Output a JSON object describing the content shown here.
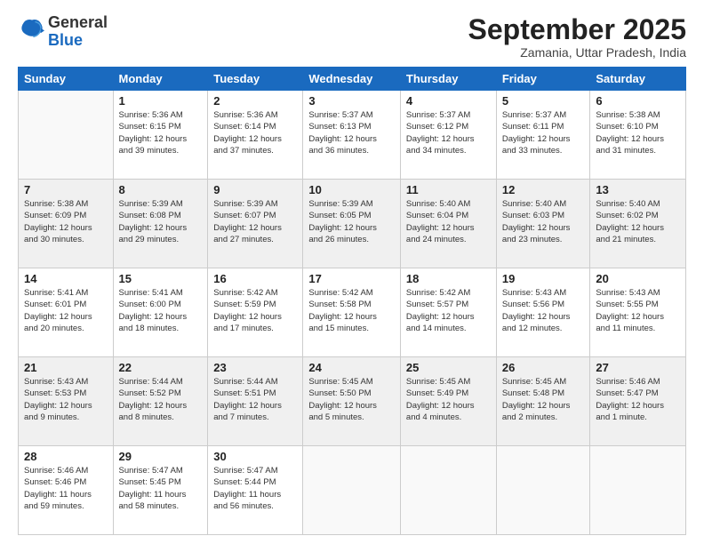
{
  "header": {
    "logo": {
      "line1": "General",
      "line2": "Blue"
    },
    "title": "September 2025",
    "subtitle": "Zamania, Uttar Pradesh, India"
  },
  "calendar": {
    "days_of_week": [
      "Sunday",
      "Monday",
      "Tuesday",
      "Wednesday",
      "Thursday",
      "Friday",
      "Saturday"
    ],
    "weeks": [
      [
        {
          "day": "",
          "info": ""
        },
        {
          "day": "1",
          "info": "Sunrise: 5:36 AM\nSunset: 6:15 PM\nDaylight: 12 hours\nand 39 minutes."
        },
        {
          "day": "2",
          "info": "Sunrise: 5:36 AM\nSunset: 6:14 PM\nDaylight: 12 hours\nand 37 minutes."
        },
        {
          "day": "3",
          "info": "Sunrise: 5:37 AM\nSunset: 6:13 PM\nDaylight: 12 hours\nand 36 minutes."
        },
        {
          "day": "4",
          "info": "Sunrise: 5:37 AM\nSunset: 6:12 PM\nDaylight: 12 hours\nand 34 minutes."
        },
        {
          "day": "5",
          "info": "Sunrise: 5:37 AM\nSunset: 6:11 PM\nDaylight: 12 hours\nand 33 minutes."
        },
        {
          "day": "6",
          "info": "Sunrise: 5:38 AM\nSunset: 6:10 PM\nDaylight: 12 hours\nand 31 minutes."
        }
      ],
      [
        {
          "day": "7",
          "info": "Sunrise: 5:38 AM\nSunset: 6:09 PM\nDaylight: 12 hours\nand 30 minutes."
        },
        {
          "day": "8",
          "info": "Sunrise: 5:39 AM\nSunset: 6:08 PM\nDaylight: 12 hours\nand 29 minutes."
        },
        {
          "day": "9",
          "info": "Sunrise: 5:39 AM\nSunset: 6:07 PM\nDaylight: 12 hours\nand 27 minutes."
        },
        {
          "day": "10",
          "info": "Sunrise: 5:39 AM\nSunset: 6:05 PM\nDaylight: 12 hours\nand 26 minutes."
        },
        {
          "day": "11",
          "info": "Sunrise: 5:40 AM\nSunset: 6:04 PM\nDaylight: 12 hours\nand 24 minutes."
        },
        {
          "day": "12",
          "info": "Sunrise: 5:40 AM\nSunset: 6:03 PM\nDaylight: 12 hours\nand 23 minutes."
        },
        {
          "day": "13",
          "info": "Sunrise: 5:40 AM\nSunset: 6:02 PM\nDaylight: 12 hours\nand 21 minutes."
        }
      ],
      [
        {
          "day": "14",
          "info": "Sunrise: 5:41 AM\nSunset: 6:01 PM\nDaylight: 12 hours\nand 20 minutes."
        },
        {
          "day": "15",
          "info": "Sunrise: 5:41 AM\nSunset: 6:00 PM\nDaylight: 12 hours\nand 18 minutes."
        },
        {
          "day": "16",
          "info": "Sunrise: 5:42 AM\nSunset: 5:59 PM\nDaylight: 12 hours\nand 17 minutes."
        },
        {
          "day": "17",
          "info": "Sunrise: 5:42 AM\nSunset: 5:58 PM\nDaylight: 12 hours\nand 15 minutes."
        },
        {
          "day": "18",
          "info": "Sunrise: 5:42 AM\nSunset: 5:57 PM\nDaylight: 12 hours\nand 14 minutes."
        },
        {
          "day": "19",
          "info": "Sunrise: 5:43 AM\nSunset: 5:56 PM\nDaylight: 12 hours\nand 12 minutes."
        },
        {
          "day": "20",
          "info": "Sunrise: 5:43 AM\nSunset: 5:55 PM\nDaylight: 12 hours\nand 11 minutes."
        }
      ],
      [
        {
          "day": "21",
          "info": "Sunrise: 5:43 AM\nSunset: 5:53 PM\nDaylight: 12 hours\nand 9 minutes."
        },
        {
          "day": "22",
          "info": "Sunrise: 5:44 AM\nSunset: 5:52 PM\nDaylight: 12 hours\nand 8 minutes."
        },
        {
          "day": "23",
          "info": "Sunrise: 5:44 AM\nSunset: 5:51 PM\nDaylight: 12 hours\nand 7 minutes."
        },
        {
          "day": "24",
          "info": "Sunrise: 5:45 AM\nSunset: 5:50 PM\nDaylight: 12 hours\nand 5 minutes."
        },
        {
          "day": "25",
          "info": "Sunrise: 5:45 AM\nSunset: 5:49 PM\nDaylight: 12 hours\nand 4 minutes."
        },
        {
          "day": "26",
          "info": "Sunrise: 5:45 AM\nSunset: 5:48 PM\nDaylight: 12 hours\nand 2 minutes."
        },
        {
          "day": "27",
          "info": "Sunrise: 5:46 AM\nSunset: 5:47 PM\nDaylight: 12 hours\nand 1 minute."
        }
      ],
      [
        {
          "day": "28",
          "info": "Sunrise: 5:46 AM\nSunset: 5:46 PM\nDaylight: 11 hours\nand 59 minutes."
        },
        {
          "day": "29",
          "info": "Sunrise: 5:47 AM\nSunset: 5:45 PM\nDaylight: 11 hours\nand 58 minutes."
        },
        {
          "day": "30",
          "info": "Sunrise: 5:47 AM\nSunset: 5:44 PM\nDaylight: 11 hours\nand 56 minutes."
        },
        {
          "day": "",
          "info": ""
        },
        {
          "day": "",
          "info": ""
        },
        {
          "day": "",
          "info": ""
        },
        {
          "day": "",
          "info": ""
        }
      ]
    ]
  }
}
